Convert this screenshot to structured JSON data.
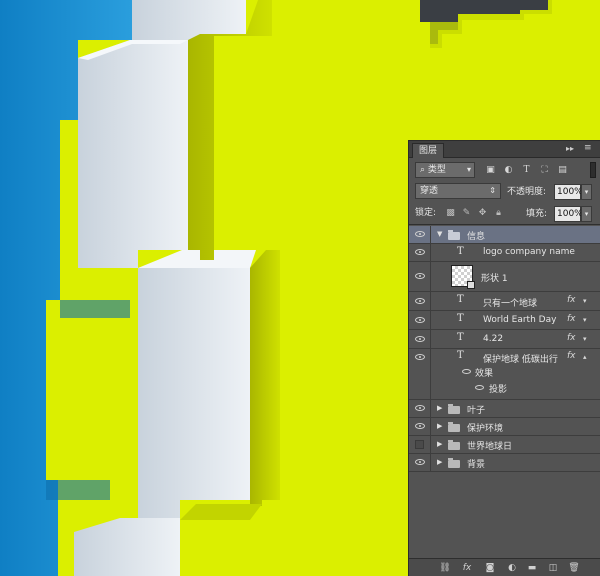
{
  "artwork": {
    "colors": {
      "blue": "#1b8fd4",
      "white": "#dfe6ee",
      "yellow": "#dbef00"
    }
  },
  "panel": {
    "tab_label": "图层",
    "collapse_glyph": "▸▸",
    "menu_glyph": "≡",
    "filter": {
      "label": "类型",
      "search_glyph": "⌕",
      "arrow": "▾"
    },
    "filter_icons": [
      "image-filter-icon",
      "adjustment-filter-icon",
      "type-filter-icon",
      "shape-filter-icon",
      "smart-object-filter-icon"
    ],
    "blend_mode": {
      "value": "穿透",
      "arrow": "⇕"
    },
    "opacity": {
      "label": "不透明度:",
      "value": "100%"
    },
    "lock": {
      "label": "锁定:",
      "icons": [
        "lock-transparent-icon",
        "lock-paint-icon",
        "lock-position-icon",
        "lock-all-icon"
      ]
    },
    "fill": {
      "label": "填充:",
      "value": "100%"
    },
    "layers": [
      {
        "name": "信息",
        "type": "group",
        "expanded": true,
        "selected": true,
        "visible": true
      },
      {
        "name": "logo company name",
        "type": "text",
        "visible": true
      },
      {
        "name": "形状 1",
        "type": "shape",
        "visible": true
      },
      {
        "name": "只有一个地球",
        "type": "text",
        "fx": true,
        "visible": true
      },
      {
        "name": "World Earth Day",
        "type": "text",
        "fx": true,
        "visible": true
      },
      {
        "name": "4.22",
        "type": "text",
        "fx": true,
        "visible": true
      },
      {
        "name": "保护地球 低碳出行",
        "type": "text",
        "fx": true,
        "visible": true
      },
      {
        "name": "效果",
        "type": "effects-header",
        "visible": true
      },
      {
        "name": "投影",
        "type": "effect",
        "visible": true
      },
      {
        "name": "叶子",
        "type": "group",
        "expanded": false,
        "visible": true
      },
      {
        "name": "保护环境",
        "type": "group",
        "expanded": false,
        "visible": true
      },
      {
        "name": "世界地球日",
        "type": "group",
        "expanded": false,
        "visible": false
      },
      {
        "name": "背景",
        "type": "group",
        "expanded": false,
        "visible": true
      }
    ],
    "fx_label": "fx",
    "bottom_icons": [
      "link-layers-icon",
      "add-style-icon",
      "add-mask-icon",
      "new-adjustment-icon",
      "new-group-icon",
      "new-layer-icon",
      "delete-layer-icon"
    ]
  }
}
